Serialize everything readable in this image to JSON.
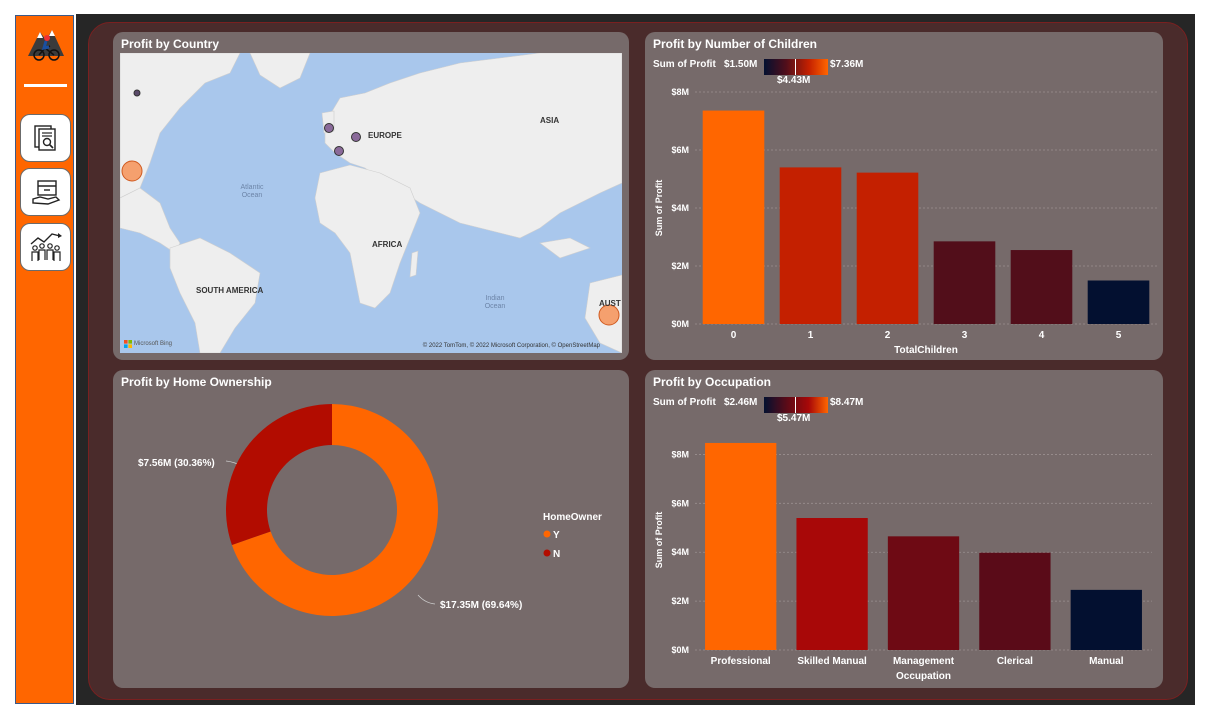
{
  "app": {
    "brand_color": "#FF6600",
    "canvas_color": "#262626",
    "frame_color": "#4a2b2b",
    "panel_color": "#766a6a"
  },
  "sidebar": {
    "items": [
      {
        "name": "report-search-icon"
      },
      {
        "name": "product-box-icon"
      },
      {
        "name": "customers-growth-icon"
      }
    ]
  },
  "map_panel": {
    "title": "Profit by Country",
    "labels": {
      "europe": "EUROPE",
      "asia": "ASIA",
      "africa": "AFRICA",
      "south_america": "SOUTH AMERICA",
      "australia": "AUST",
      "atlantic": "Atlantic\nOcean",
      "indian": "Indian\nOcean"
    },
    "credit": "© 2022 TomTom, © 2022 Microsoft Corporation, © OpenStreetMap",
    "bing": "Microsoft Bing"
  },
  "children_panel": {
    "title": "Profit by Number of Children",
    "legend": {
      "label": "Sum of Profit",
      "min": "$1.50M",
      "max": "$7.36M",
      "mid": "$4.43M"
    }
  },
  "home_panel": {
    "title": "Profit by Home Ownership",
    "legend_title": "HomeOwner",
    "label_n": "$7.56M (30.36%)",
    "label_y": "$17.35M (69.64%)"
  },
  "occupation_panel": {
    "title": "Profit by Occupation",
    "legend": {
      "label": "Sum of Profit",
      "min": "$2.46M",
      "max": "$8.47M",
      "mid": "$5.47M"
    }
  },
  "chart_data": [
    {
      "type": "bar",
      "title": "Profit by Number of Children",
      "xlabel": "TotalChildren",
      "ylabel": "Sum of Profit",
      "categories": [
        "0",
        "1",
        "2",
        "3",
        "4",
        "5"
      ],
      "values": [
        7.36,
        5.4,
        5.22,
        2.85,
        2.55,
        1.5
      ],
      "colors": [
        "#FF6600",
        "#C42000",
        "#C42000",
        "#520E1A",
        "#520E1A",
        "#031030"
      ],
      "ylim": [
        0,
        8
      ],
      "yticks": [
        0,
        2,
        4,
        6,
        8
      ],
      "ytick_labels": [
        "$0M",
        "$2M",
        "$4M",
        "$6M",
        "$8M"
      ],
      "grid": true
    },
    {
      "type": "pie",
      "title": "Profit by Home Ownership",
      "categories": [
        "Y",
        "N"
      ],
      "values": [
        17.35,
        7.56
      ],
      "percents": [
        69.64,
        30.36
      ],
      "colors": [
        "#FF6600",
        "#B20C00"
      ],
      "donut": true,
      "legend": "right"
    },
    {
      "type": "bar",
      "title": "Profit by Occupation",
      "xlabel": "Occupation",
      "ylabel": "Sum of Profit",
      "categories": [
        "Professional",
        "Skilled Manual",
        "Management",
        "Clerical",
        "Manual"
      ],
      "values": [
        8.47,
        5.4,
        4.65,
        3.98,
        2.46
      ],
      "colors": [
        "#FF6600",
        "#A80808",
        "#6E0A14",
        "#5A0B18",
        "#031030"
      ],
      "ylim": [
        0,
        9
      ],
      "yticks": [
        0,
        2,
        4,
        6,
        8
      ],
      "ytick_labels": [
        "$0M",
        "$2M",
        "$4M",
        "$6M",
        "$8M"
      ],
      "grid": true
    }
  ]
}
